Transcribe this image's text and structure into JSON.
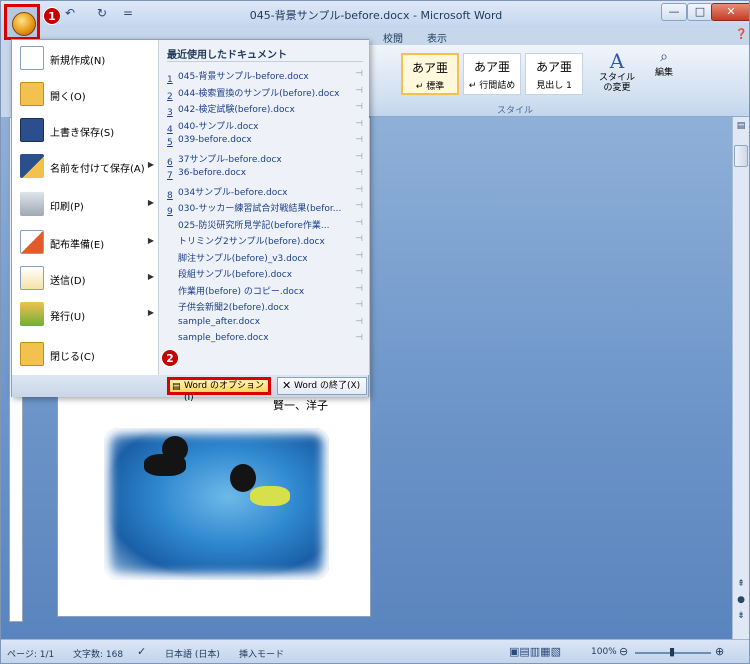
{
  "window": {
    "title": "045-背景サンプル-before.docx - Microsoft Word"
  },
  "qat": {
    "undo": "↶",
    "redo": "↻",
    "customize": "="
  },
  "steps": {
    "one": "1",
    "two": "2"
  },
  "tabs": {
    "review": "校閲",
    "view": "表示"
  },
  "ribbon": {
    "styles": [
      {
        "glyph": "あア亜",
        "name": "↵ 標準"
      },
      {
        "glyph": "あア亜",
        "name": "↵ 行間詰め"
      },
      {
        "glyph": "あア亜",
        "name": "見出し 1"
      }
    ],
    "change_styles": "スタイルの変更",
    "styles_group": "スタイル",
    "edit": "編集"
  },
  "menu": {
    "items": [
      {
        "label": "新規作成(N)",
        "has_arrow": false
      },
      {
        "label": "開く(O)",
        "has_arrow": false
      },
      {
        "label": "上書き保存(S)",
        "has_arrow": false
      },
      {
        "label": "名前を付けて保存(A)",
        "has_arrow": true
      },
      {
        "label": "印刷(P)",
        "has_arrow": true
      },
      {
        "label": "配布準備(E)",
        "has_arrow": true
      },
      {
        "label": "送信(D)",
        "has_arrow": true
      },
      {
        "label": "発行(U)",
        "has_arrow": true
      },
      {
        "label": "閉じる(C)",
        "has_arrow": false
      }
    ],
    "recent_heading": "最近使用したドキュメント",
    "recent": [
      {
        "num": "1",
        "name": "045-背景サンプル-before.docx"
      },
      {
        "num": "2",
        "name": "044-検索置換のサンプル(before).docx"
      },
      {
        "num": "3",
        "name": "042-検定試験(before).docx"
      },
      {
        "num": "4",
        "name": "040-サンプル.docx"
      },
      {
        "num": "5",
        "name": "039-before.docx"
      },
      {
        "num": "6",
        "name": "37サンプル-before.docx"
      },
      {
        "num": "7",
        "name": "36-before.docx"
      },
      {
        "num": "8",
        "name": "034サンプル-before.docx"
      },
      {
        "num": "9",
        "name": "030-サッカー練習試合対戦結果(befor..."
      },
      {
        "num": "",
        "name": "025-防災研究所見学記(before作業..."
      },
      {
        "num": "",
        "name": "トリミング2サンプル(before).docx"
      },
      {
        "num": "",
        "name": "脚注サンプル(before)_v3.docx"
      },
      {
        "num": "",
        "name": "段組サンプル(before).docx"
      },
      {
        "num": "",
        "name": "作業用(before) のコピー.docx"
      },
      {
        "num": "",
        "name": "子供会新聞2(before).docx"
      },
      {
        "num": "",
        "name": "sample_after.docx"
      },
      {
        "num": "",
        "name": "sample_before.docx"
      }
    ],
    "options_button": "Word のオプション(I)",
    "exit_button": "Word の終了(X)"
  },
  "document": {
    "visible_text": "賢一、洋子"
  },
  "statusbar": {
    "page": "ページ: 1/1",
    "words": "文字数: 168",
    "language": "日本語 (日本)",
    "mode": "挿入モード",
    "zoom": "100%"
  }
}
